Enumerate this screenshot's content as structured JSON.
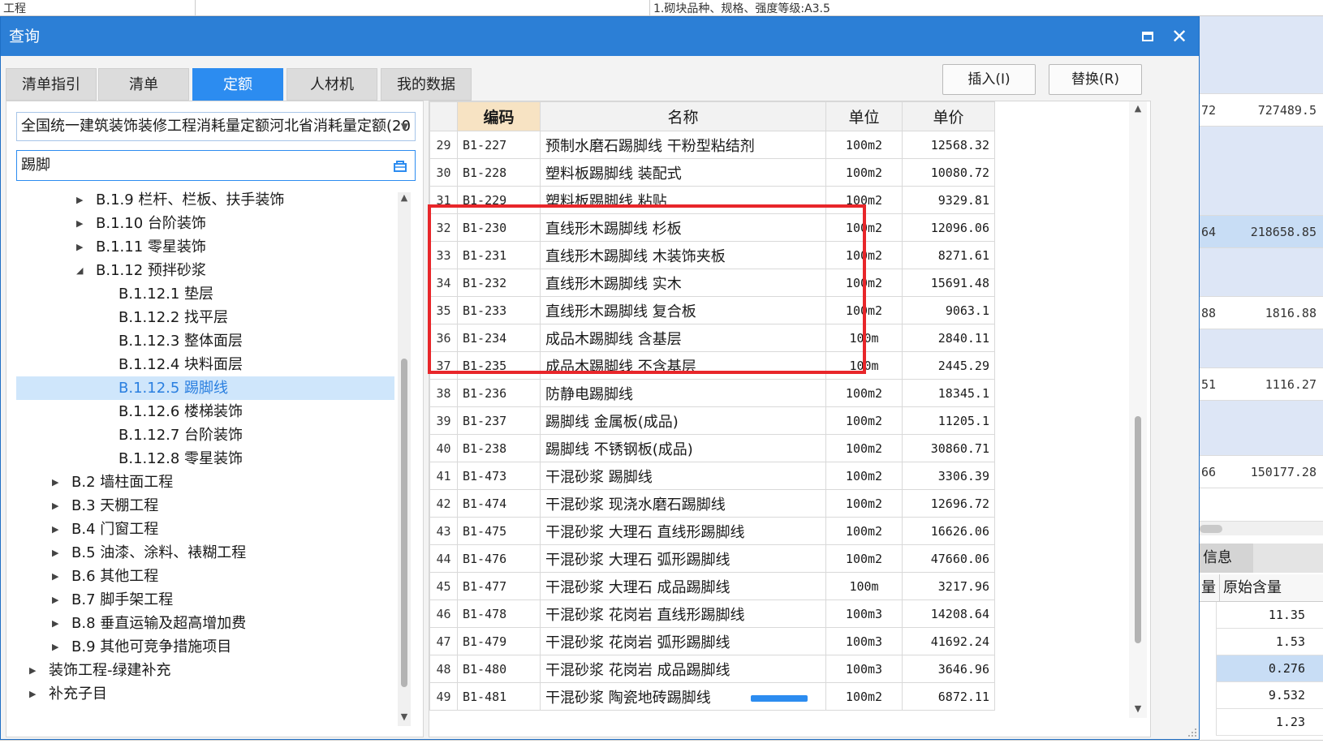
{
  "background": {
    "top_cells": [
      "工程",
      "1.砌块品种、规格、强度等级:A3.5"
    ],
    "right_rows": [
      {
        "c1": "72",
        "c2": "727489.5"
      },
      {
        "c1": "64",
        "c2": "218658.85"
      },
      {
        "c1": "88",
        "c2": "1816.88"
      },
      {
        "c1": "51",
        "c2": "1116.27"
      },
      {
        "c1": "66",
        "c2": "150177.28"
      }
    ],
    "info_tab": "信息",
    "info_header": {
      "col1": "量",
      "col2": "原始含量"
    },
    "info_values": [
      "11.35",
      "1.53",
      "0.276",
      "9.532",
      "1.23"
    ]
  },
  "dialog": {
    "title": "查询",
    "maximize_label": "",
    "close_label": "✕",
    "tabs": [
      {
        "label": "清单指引",
        "active": false
      },
      {
        "label": "清单",
        "active": false
      },
      {
        "label": "定额",
        "active": true
      },
      {
        "label": "人材机",
        "active": false
      },
      {
        "label": "我的数据",
        "active": false
      }
    ],
    "insert_button": "插入(I)",
    "replace_button": "替换(R)",
    "library_select": "全国统一建筑装饰装修工程消耗量定额河北省消耗量定额(20",
    "search_value": "踢脚",
    "tree": [
      {
        "label": "B.1.9 栏杆、栏板、扶手装饰",
        "level": 2,
        "arrow": "▶"
      },
      {
        "label": "B.1.10 台阶装饰",
        "level": 2,
        "arrow": "▶"
      },
      {
        "label": "B.1.11 零星装饰",
        "level": 2,
        "arrow": "▶"
      },
      {
        "label": "B.1.12 预拌砂浆",
        "level": 2,
        "arrow": "◢"
      },
      {
        "label": "B.1.12.1 垫层",
        "level": 3,
        "arrow": ""
      },
      {
        "label": "B.1.12.2 找平层",
        "level": 3,
        "arrow": ""
      },
      {
        "label": "B.1.12.3 整体面层",
        "level": 3,
        "arrow": ""
      },
      {
        "label": "B.1.12.4 块料面层",
        "level": 3,
        "arrow": ""
      },
      {
        "label": "B.1.12.5 踢脚线",
        "level": 3,
        "arrow": "",
        "selected": true
      },
      {
        "label": "B.1.12.6 楼梯装饰",
        "level": 3,
        "arrow": ""
      },
      {
        "label": "B.1.12.7 台阶装饰",
        "level": 3,
        "arrow": ""
      },
      {
        "label": "B.1.12.8 零星装饰",
        "level": 3,
        "arrow": ""
      },
      {
        "label": "B.2 墙柱面工程",
        "level": 1,
        "arrow": "▶"
      },
      {
        "label": "B.3 天棚工程",
        "level": 1,
        "arrow": "▶"
      },
      {
        "label": "B.4 门窗工程",
        "level": 1,
        "arrow": "▶"
      },
      {
        "label": "B.5 油漆、涂料、裱糊工程",
        "level": 1,
        "arrow": "▶"
      },
      {
        "label": "B.6 其他工程",
        "level": 1,
        "arrow": "▶"
      },
      {
        "label": "B.7 脚手架工程",
        "level": 1,
        "arrow": "▶"
      },
      {
        "label": "B.8 垂直运输及超高增加费",
        "level": 1,
        "arrow": "▶"
      },
      {
        "label": "B.9 其他可竞争措施项目",
        "level": 1,
        "arrow": "▶"
      },
      {
        "label": "装饰工程-绿建补充",
        "level": 0,
        "arrow": "▶"
      },
      {
        "label": "补充子目",
        "level": 0,
        "arrow": "▶"
      }
    ],
    "table": {
      "headers": {
        "code": "编码",
        "name": "名称",
        "unit": "单位",
        "price": "单价"
      },
      "rows": [
        {
          "n": "29",
          "code": "B1-227",
          "name": "预制水磨石踢脚线 干粉型粘结剂",
          "unit": "100m2",
          "price": "12568.32"
        },
        {
          "n": "30",
          "code": "B1-228",
          "name": "塑料板踢脚线 装配式",
          "unit": "100m2",
          "price": "10080.72"
        },
        {
          "n": "31",
          "code": "B1-229",
          "name": "塑料板踢脚线 粘贴",
          "unit": "100m2",
          "price": "9329.81"
        },
        {
          "n": "32",
          "code": "B1-230",
          "name": "直线形木踢脚线 杉板",
          "unit": "100m2",
          "price": "12096.06"
        },
        {
          "n": "33",
          "code": "B1-231",
          "name": "直线形木踢脚线 木装饰夹板",
          "unit": "100m2",
          "price": "8271.61"
        },
        {
          "n": "34",
          "code": "B1-232",
          "name": "直线形木踢脚线 实木",
          "unit": "100m2",
          "price": "15691.48"
        },
        {
          "n": "35",
          "code": "B1-233",
          "name": "直线形木踢脚线 复合板",
          "unit": "100m2",
          "price": "9063.1"
        },
        {
          "n": "36",
          "code": "B1-234",
          "name": "成品木踢脚线 含基层",
          "unit": "100m",
          "price": "2840.11"
        },
        {
          "n": "37",
          "code": "B1-235",
          "name": "成品木踢脚线 不含基层",
          "unit": "100m",
          "price": "2445.29"
        },
        {
          "n": "38",
          "code": "B1-236",
          "name": "防静电踢脚线",
          "unit": "100m2",
          "price": "18345.1"
        },
        {
          "n": "39",
          "code": "B1-237",
          "name": "踢脚线 金属板(成品)",
          "unit": "100m2",
          "price": "11205.1"
        },
        {
          "n": "40",
          "code": "B1-238",
          "name": "踢脚线 不锈钢板(成品)",
          "unit": "100m2",
          "price": "30860.71"
        },
        {
          "n": "41",
          "code": "B1-473",
          "name": "干混砂浆 踢脚线",
          "unit": "100m2",
          "price": "3306.39"
        },
        {
          "n": "42",
          "code": "B1-474",
          "name": "干混砂浆 现浇水磨石踢脚线",
          "unit": "100m2",
          "price": "12696.72"
        },
        {
          "n": "43",
          "code": "B1-475",
          "name": "干混砂浆 大理石 直线形踢脚线",
          "unit": "100m2",
          "price": "16626.06"
        },
        {
          "n": "44",
          "code": "B1-476",
          "name": "干混砂浆 大理石 弧形踢脚线",
          "unit": "100m2",
          "price": "47660.06"
        },
        {
          "n": "45",
          "code": "B1-477",
          "name": "干混砂浆 大理石 成品踢脚线",
          "unit": "100m",
          "price": "3217.96"
        },
        {
          "n": "46",
          "code": "B1-478",
          "name": "干混砂浆 花岗岩 直线形踢脚线",
          "unit": "100m3",
          "price": "14208.64"
        },
        {
          "n": "47",
          "code": "B1-479",
          "name": "干混砂浆 花岗岩 弧形踢脚线",
          "unit": "100m3",
          "price": "41692.24"
        },
        {
          "n": "48",
          "code": "B1-480",
          "name": "干混砂浆 花岗岩 成品踢脚线",
          "unit": "100m3",
          "price": "3646.96"
        },
        {
          "n": "49",
          "code": "B1-481",
          "name": "干混砂浆 陶瓷地砖踢脚线",
          "unit": "100m2",
          "price": "6872.11"
        }
      ]
    }
  },
  "colors": {
    "title_bar": "#2c7fd6",
    "active_tab": "#2c8cf0",
    "highlight_box": "#e8262a",
    "selected_tree": "#cfe6fb"
  }
}
